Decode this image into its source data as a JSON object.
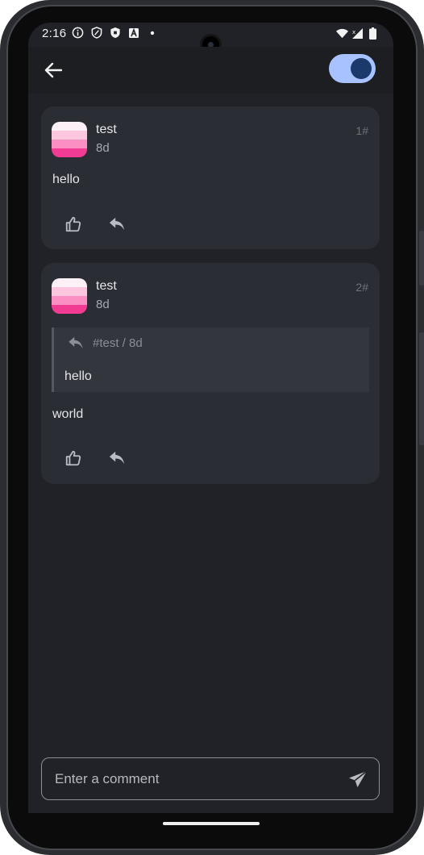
{
  "status_bar": {
    "time": "2:16",
    "left_icons": [
      "info-icon",
      "shield-icon",
      "shield-filled-icon",
      "app-a-icon",
      "dot-icon"
    ],
    "right_icons": [
      "wifi-icon",
      "signal-icon",
      "battery-icon"
    ]
  },
  "app_bar": {
    "back_icon": "arrow-left-icon",
    "toggle_on": true
  },
  "posts": [
    {
      "user": "test",
      "time": "8d",
      "number": "1#",
      "body": "hello",
      "actions": [
        "thumbs-up-icon",
        "reply-icon"
      ]
    },
    {
      "user": "test",
      "time": "8d",
      "number": "2#",
      "quote": {
        "header": "#test / 8d",
        "body": "hello"
      },
      "body": "world",
      "actions": [
        "thumbs-up-icon",
        "reply-icon"
      ]
    }
  ],
  "comment": {
    "placeholder": "Enter a comment",
    "send_icon": "send-icon"
  },
  "colors": {
    "background": "#202227",
    "card": "#2a2d33",
    "accent": "#a8c2ff",
    "accent_dark": "#1b3a6b"
  }
}
